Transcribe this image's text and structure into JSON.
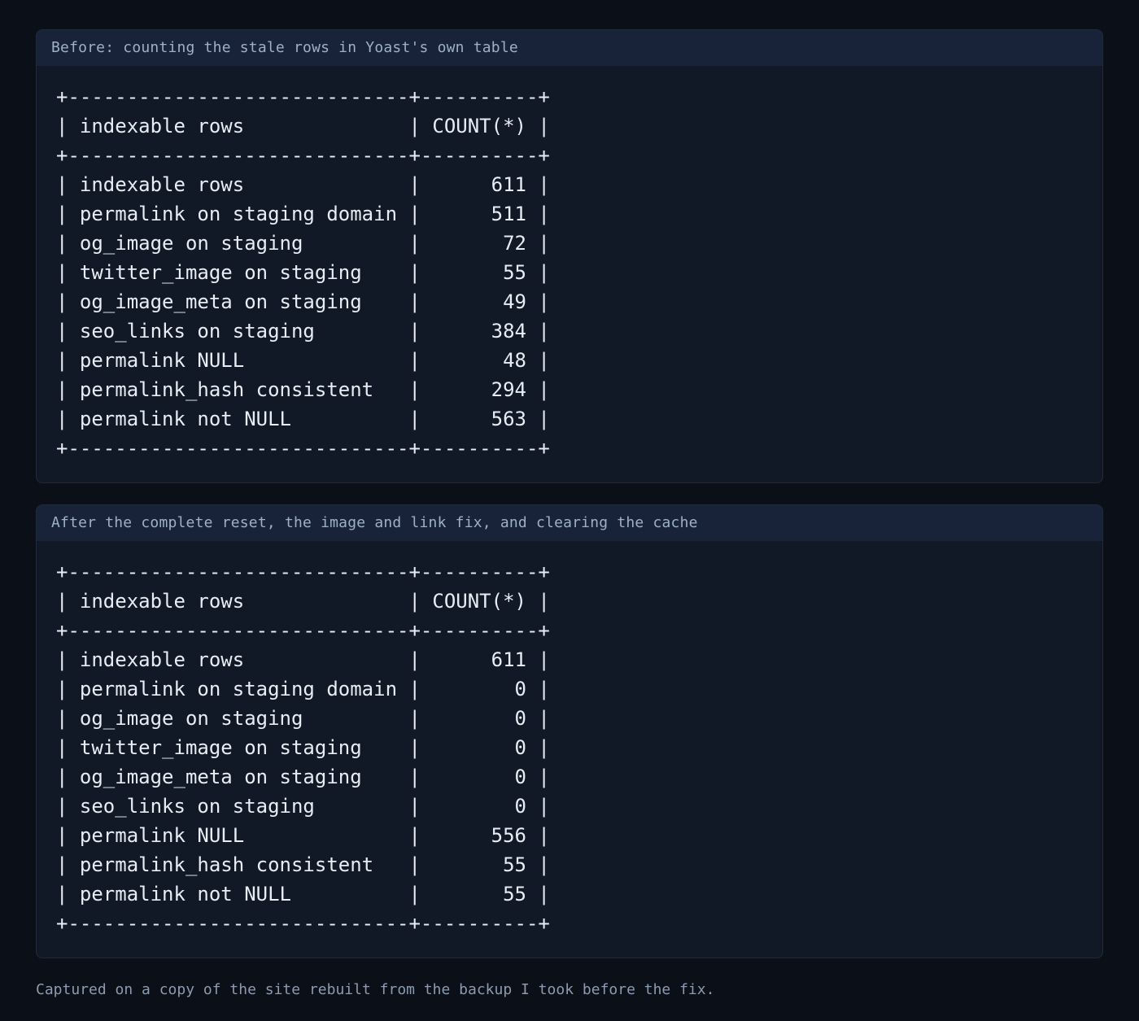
{
  "panels": [
    {
      "title": "Before: counting the stale rows in Yoast's own table",
      "lines": [
        "+-----------------------------+----------+",
        "| indexable rows              | COUNT(*) |",
        "+-----------------------------+----------+",
        "| indexable rows              |      611 |",
        "| permalink on staging domain |      511 |",
        "| og_image on staging         |       72 |",
        "| twitter_image on staging    |       55 |",
        "| og_image_meta on staging    |       49 |",
        "| seo_links on staging        |      384 |",
        "| permalink NULL              |       48 |",
        "| permalink_hash consistent   |      294 |",
        "| permalink not NULL          |      563 |",
        "+-----------------------------+----------+"
      ]
    },
    {
      "title": "After the complete reset, the image and link fix, and clearing the cache",
      "lines": [
        "+-----------------------------+----------+",
        "| indexable rows              | COUNT(*) |",
        "+-----------------------------+----------+",
        "| indexable rows              |      611 |",
        "| permalink on staging domain |        0 |",
        "| og_image on staging         |        0 |",
        "| twitter_image on staging    |        0 |",
        "| og_image_meta on staging    |        0 |",
        "| seo_links on staging        |        0 |",
        "| permalink NULL              |      556 |",
        "| permalink_hash consistent   |       55 |",
        "| permalink not NULL          |       55 |",
        "+-----------------------------+----------+"
      ]
    }
  ],
  "caption": "Captured on a copy of the site rebuilt from the backup I took before the fix."
}
